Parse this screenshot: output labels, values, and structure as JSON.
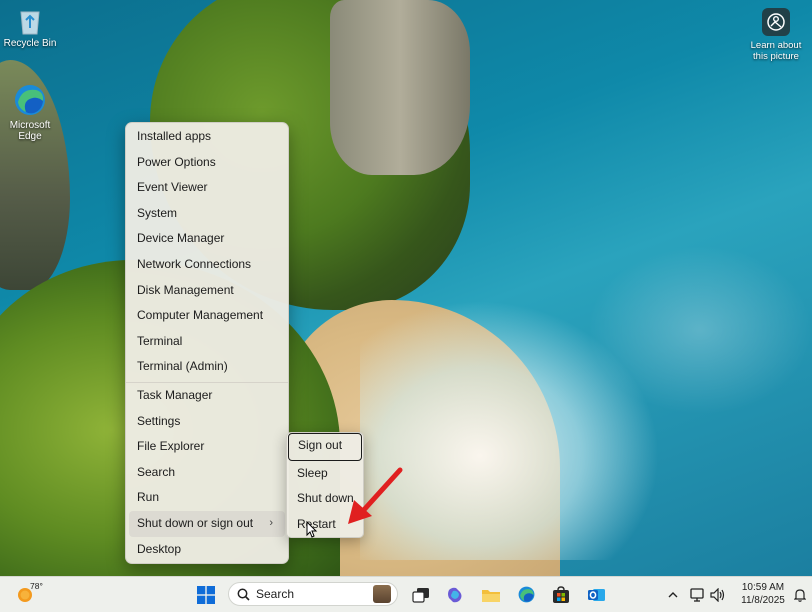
{
  "desktop": {
    "icons": [
      {
        "label": "Recycle Bin",
        "icon": "recycle-bin-icon"
      },
      {
        "label": "Microsoft Edge",
        "icon": "edge-icon"
      }
    ],
    "learn_about": "Learn about this picture"
  },
  "winx_menu": {
    "items": [
      {
        "label": "Installed apps"
      },
      {
        "label": "Power Options"
      },
      {
        "label": "Event Viewer"
      },
      {
        "label": "System"
      },
      {
        "label": "Device Manager"
      },
      {
        "label": "Network Connections"
      },
      {
        "label": "Disk Management"
      },
      {
        "label": "Computer Management"
      },
      {
        "label": "Terminal"
      },
      {
        "label": "Terminal (Admin)"
      },
      {
        "label": "Task Manager"
      },
      {
        "label": "Settings"
      },
      {
        "label": "File Explorer"
      },
      {
        "label": "Search"
      },
      {
        "label": "Run"
      },
      {
        "label": "Shut down or sign out"
      },
      {
        "label": "Desktop"
      }
    ],
    "submenu_arrow": "›"
  },
  "shutdown_submenu": {
    "items": [
      {
        "label": "Sign out"
      },
      {
        "label": "Sleep"
      },
      {
        "label": "Shut down"
      },
      {
        "label": "Restart"
      }
    ]
  },
  "taskbar": {
    "weather_temp": "78°",
    "search_placeholder": "Search",
    "apps": [
      "start-icon",
      "task-view-icon",
      "copilot-icon",
      "file-explorer-icon",
      "edge-icon",
      "store-icon",
      "outlook-icon"
    ],
    "clock_time": "10:59 AM",
    "clock_date": "11/8/2025"
  },
  "colors": {
    "accent_red": "#e02020",
    "start_blue": "#0f6cd8"
  }
}
